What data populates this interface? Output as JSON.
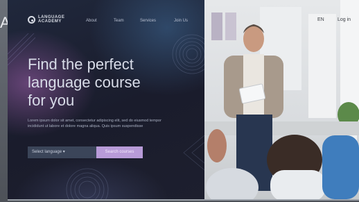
{
  "edge_text": "AY",
  "brand": {
    "line1": "LANGUAGE",
    "line2": "ACADEMY"
  },
  "nav": [
    {
      "label": "About"
    },
    {
      "label": "Team"
    },
    {
      "label": "Services"
    },
    {
      "label": "Join Us"
    }
  ],
  "right_nav": [
    {
      "label": "EN"
    },
    {
      "label": "Log in"
    }
  ],
  "hero": {
    "title_line1": "Find the perfect",
    "title_line2": "language course",
    "title_line3": "for you",
    "body": "Lorem ipsum dolor sit amet, consectetur adipiscing elit, sed do eiusmod tempor incididunt ut labore et dolore magna aliqua. Quis ipsum suspendisse"
  },
  "form": {
    "select_value": "Select language",
    "select_caret": "▾",
    "button_label": "Search courses"
  },
  "colors": {
    "accent": "#b89bd8",
    "panel": "#1b1f2e",
    "select_bg": "#3b4559"
  }
}
